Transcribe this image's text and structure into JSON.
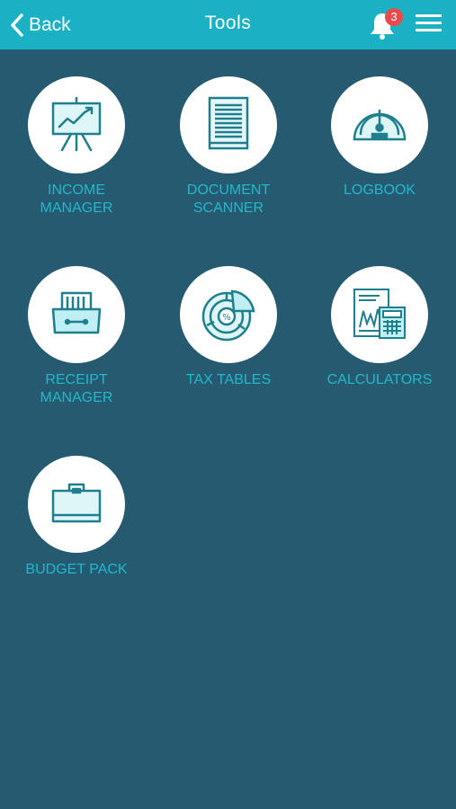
{
  "header": {
    "back_label": "Back",
    "title": "Tools",
    "notification_count": "3",
    "colors": {
      "bar": "#1ab1c4",
      "badge": "#e94b4b"
    }
  },
  "tools": [
    {
      "label": "INCOME\nMANAGER",
      "icon": "presentation-chart-icon"
    },
    {
      "label": "DOCUMENT\nSCANNER",
      "icon": "document-icon"
    },
    {
      "label": "LOGBOOK",
      "icon": "speedometer-icon"
    },
    {
      "label": "RECEIPT\nMANAGER",
      "icon": "receipt-drawer-icon"
    },
    {
      "label": "TAX TABLES",
      "icon": "percent-pie-icon"
    },
    {
      "label": "CALCULATORS",
      "icon": "calculator-icon"
    },
    {
      "label": "BUDGET PACK",
      "icon": "briefcase-icon"
    }
  ],
  "colors": {
    "background": "#265a70",
    "label": "#22b8cc",
    "icon": "#1f7f8c"
  }
}
